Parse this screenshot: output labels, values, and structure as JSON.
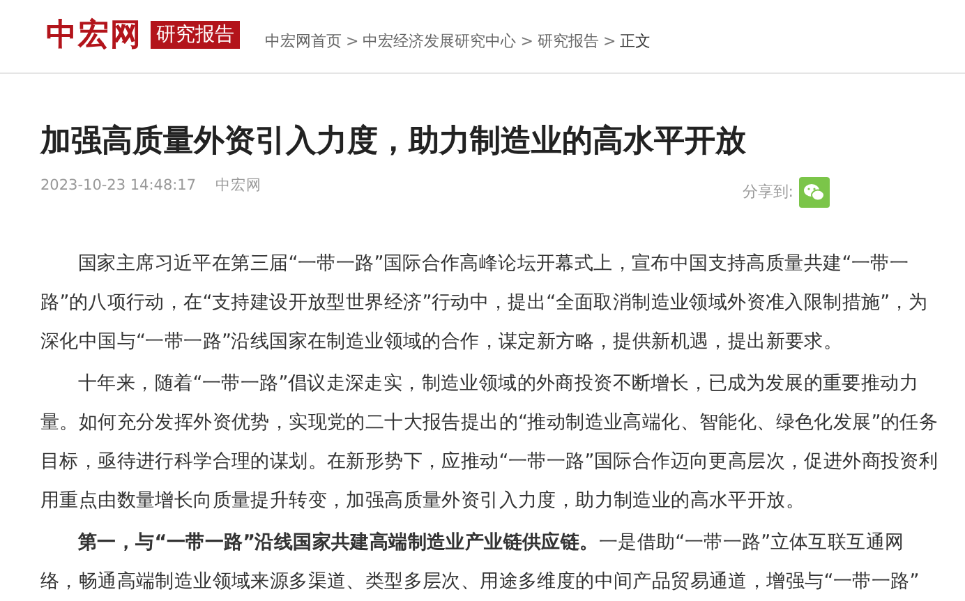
{
  "header": {
    "logo": "中宏网",
    "section_badge": "研究报告",
    "breadcrumb": [
      {
        "label": "中宏网首页",
        "kind": "link"
      },
      {
        "label": "中宏经济发展研究中心",
        "kind": "link"
      },
      {
        "label": "研究报告",
        "kind": "link"
      },
      {
        "label": "正文",
        "kind": "current"
      }
    ],
    "separator": ">"
  },
  "article": {
    "title": "加强高质量外资引入力度，助力制造业的高水平开放",
    "date": "2023-10-23 14:48:17",
    "source": "中宏网",
    "share_label": "分享到:",
    "paragraphs": [
      "国家主席习近平在第三届“一带一路”国际合作高峰论坛开幕式上，宣布中国支持高质量共建“一带一路”的八项行动，在“支持建设开放型世界经济”行动中，提出“全面取消制造业领域外资准入限制措施”，为深化中国与“一带一路”沿线国家在制造业领域的合作，谋定新方略，提供新机遇，提出新要求。",
      "十年来，随着“一带一路”倡议走深走实，制造业领域的外商投资不断增长，已成为发展的重要推动力量。如何充分发挥外资优势，实现党的二十大报告提出的“推动制造业高端化、智能化、绿色化发展”的任务目标，亟待进行科学合理的谋划。在新形势下，应推动“一带一路”国际合作迈向更高层次，促进外商投资利用重点由数量增长向质量提升转变，加强高质量外资引入力度，助力制造业的高水平开放。",
      "**第一，与“一带一路”沿线国家共建高端制造业产业链供应链。**一是借助“一带一路”立体互联互通网络，畅通高端制造业领域来源多渠道、类型多层次、用途多维度的中间产品贸易通道，增强与“一带一路”"
    ]
  }
}
